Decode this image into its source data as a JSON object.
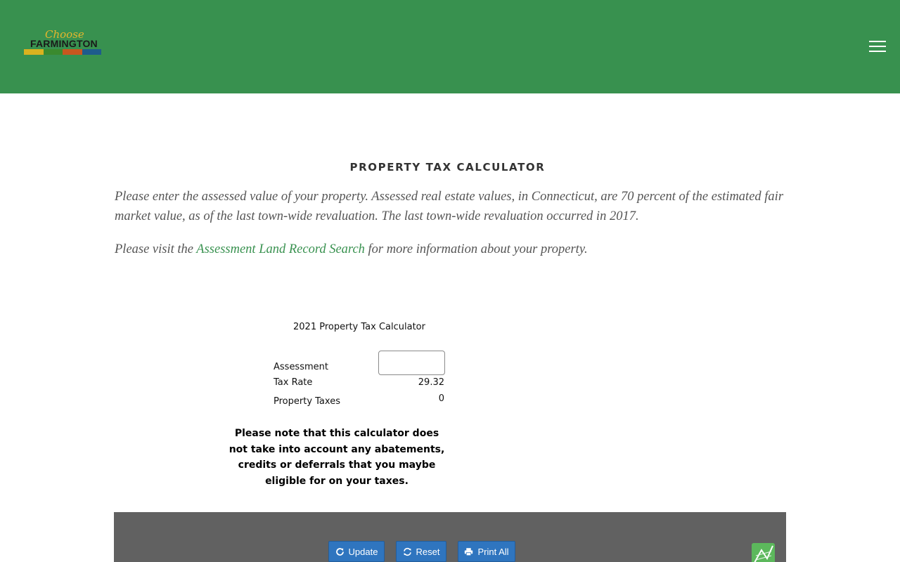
{
  "header": {
    "logo": {
      "script_text": "Choose",
      "word_text": "FARMINGTON",
      "bar_colors": [
        "#d9b21f",
        "#3a8a2e",
        "#c8571f",
        "#1e5c8c"
      ]
    },
    "menu_icon": "hamburger-menu-icon",
    "background_color": "#38914f"
  },
  "page": {
    "title": "PROPERTY TAX CALCULATOR",
    "paragraph1": "Please enter the assessed value of your property. Assessed real estate values, in Connecticut, are 70 percent of the estimated fair market value, as of the last town-wide revaluation. The last town-wide revaluation occurred in 2017.",
    "paragraph2_before": "Please visit the ",
    "paragraph2_link": "Assessment Land Record Search",
    "paragraph2_after": " for more information about your property."
  },
  "calculator": {
    "title": "2021 Property Tax Calculator",
    "assessment_label": "Assessment",
    "assessment_value": "",
    "tax_rate_label": "Tax Rate",
    "tax_rate_value": "29.32",
    "property_taxes_label": "Property Taxes",
    "property_taxes_value": "0",
    "note": "Please note that this calculator does not take into account any abatements, credits or deferrals that you maybe eligible for on your taxes."
  },
  "toolbar": {
    "update_label": "Update",
    "reset_label": "Reset",
    "print_label": "Print All",
    "update_icon": "refresh-icon",
    "reset_icon": "refresh-icon",
    "print_icon": "printer-icon",
    "spreadsheet_icon": "spreadsheet-icon",
    "button_color": "#2f75bf",
    "bar_color": "#616161"
  }
}
